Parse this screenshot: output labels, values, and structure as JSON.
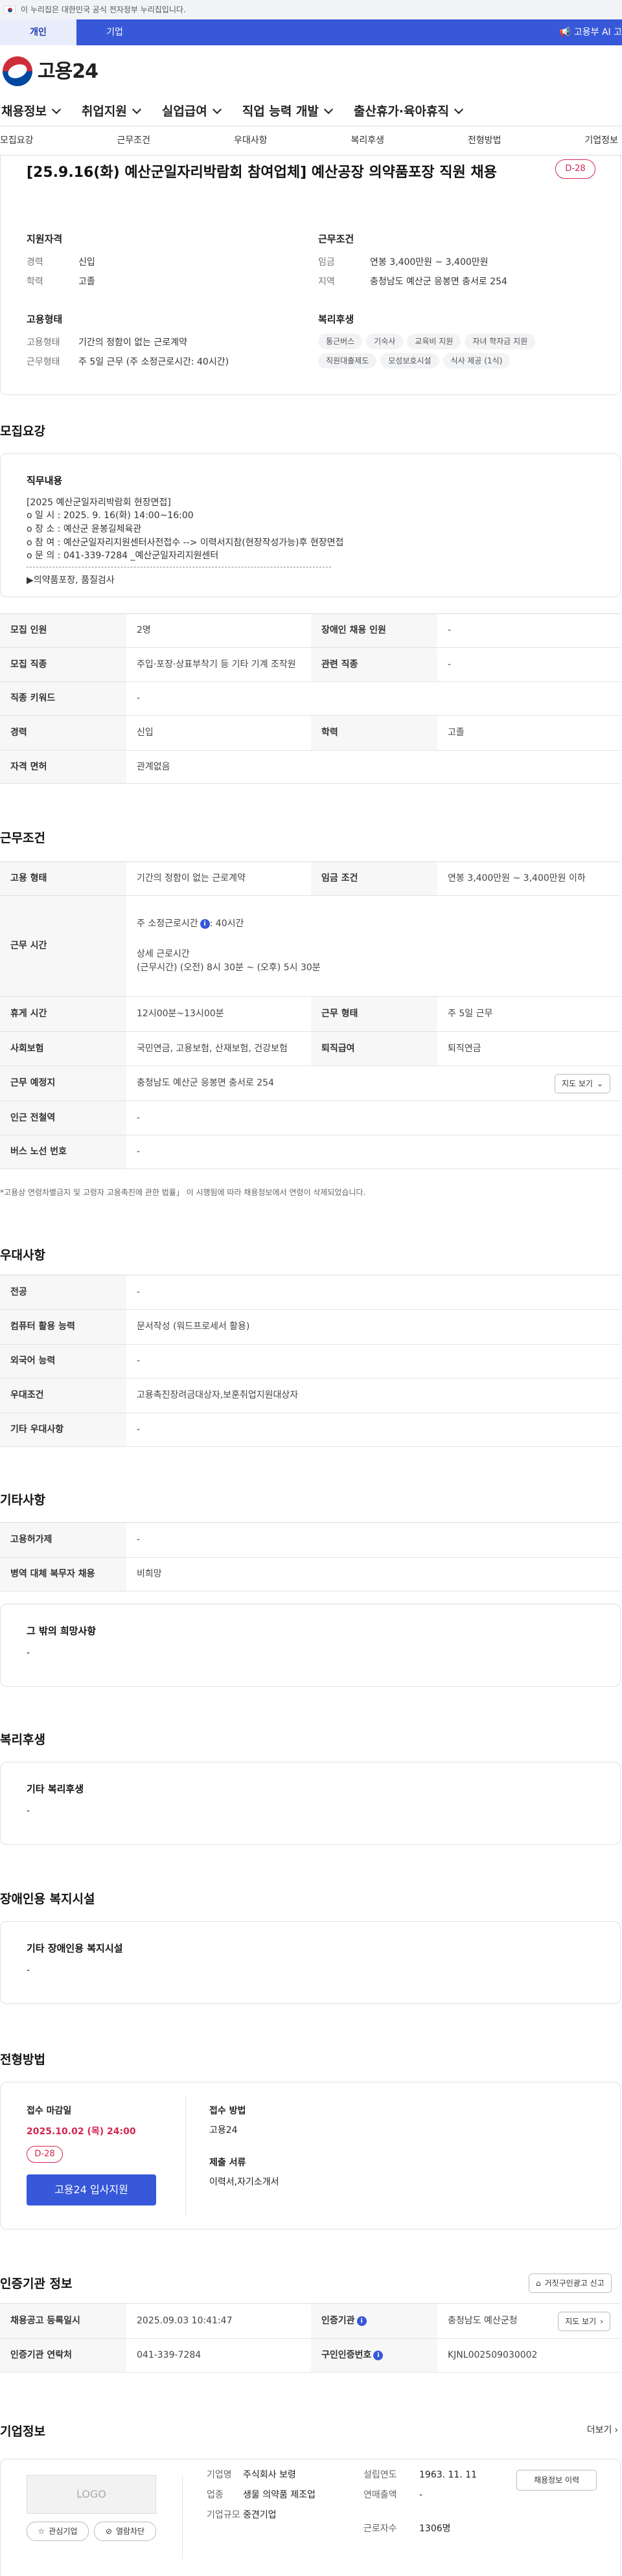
{
  "gov_banner": {
    "text": "이 누리집은 대한민국 공식 전자정부 누리집입니다."
  },
  "user_tabs": {
    "personal": "개인",
    "company": "기업",
    "ai": "고용부 AI 고"
  },
  "logo": {
    "text": "고용24"
  },
  "gnb": [
    "채용정보",
    "취업지원",
    "실업급여",
    "직업 능력 개발",
    "출산휴가·육아휴직"
  ],
  "anchor_nav": [
    "모집요강",
    "근무조건",
    "우대사항",
    "복리후생",
    "전형방법",
    "기업정보"
  ],
  "summary": {
    "title": "[25.9.16(화) 예산군일자리박람회 참여업체] 예산공장 의약품포장 직원 채용",
    "dday": "D-28",
    "qualification": {
      "heading": "지원자격",
      "rows": [
        {
          "k": "경력",
          "v": "신입"
        },
        {
          "k": "학력",
          "v": "고졸"
        }
      ]
    },
    "employment": {
      "heading": "고용형태",
      "rows": [
        {
          "k": "고용형태",
          "v": "기간의 정함이 없는 근로계약"
        },
        {
          "k": "근무형태",
          "v": "주 5일 근무 (주 소정근로시간: 40시간)"
        }
      ]
    },
    "conditions": {
      "heading": "근무조건",
      "rows": [
        {
          "k": "임금",
          "v": "연봉 3,400만원 ~ 3,400만원"
        },
        {
          "k": "지역",
          "v": "충청남도 예산군 응봉면 충서로 254"
        }
      ]
    },
    "welfare": {
      "heading": "복리후생",
      "tags": [
        "통근버스",
        "기숙사",
        "교육비 지원",
        "자녀 학자금 지원",
        "직원대출제도",
        "모성보호시설",
        "식사 제공 (1식)"
      ]
    }
  },
  "recruit": {
    "heading": "모집요강",
    "content_label": "직무내용",
    "content_lines": [
      "[2025 예산군일자리박람회 현장면접]",
      "o 일 시 : 2025. 9. 16(화) 14:00~16:00",
      "o 장 소 : 예산군 윤봉길체육관",
      "o 참 여 : 예산군일자리지원센터사전접수 --> 이력서지참(현장작성가능)후 현장면접",
      "o 문 의 : 041-339-7284 _예산군일자리지원센터"
    ],
    "content_footer": "▶의약품포장, 품질검사",
    "table": [
      {
        "k": "모집 인원",
        "v": "2명",
        "k2": "장애인 채용 인원",
        "v2": "-"
      },
      {
        "k": "모집 직종",
        "v": "주입·포장·상표부착기 등 기타 기계 조작원",
        "k2": "관련 직종",
        "v2": "-"
      },
      {
        "k": "직종 키워드",
        "v": "-"
      },
      {
        "k": "경력",
        "v": "신입",
        "k2": "학력",
        "v2": "고졸"
      },
      {
        "k": "자격 면허",
        "v": "관계없음"
      }
    ]
  },
  "work": {
    "heading": "근무조건",
    "employment_type": {
      "k": "고용 형태",
      "v": "기간의 정함이 없는 근로계약",
      "k2": "임금 조건",
      "v2": "연봉 3,400만원 ~ 3,400만원 이하"
    },
    "work_time": {
      "k": "근무 시간",
      "line1": "주 소정근로시간",
      "line1b": ": 40시간",
      "line2": "상세 근로시간",
      "line3": "(근무시간) (오전) 8시 30분 ~ (오후) 5시 30분"
    },
    "rest": {
      "k": "휴게 시간",
      "v": "12시00분~13시00분",
      "k2": "근무 형태",
      "v2": "주 5일 근무"
    },
    "insurance": {
      "k": "사회보험",
      "v": "국민연금, 고용보험, 산재보험, 건강보험",
      "k2": "퇴직급여",
      "v2": "퇴직연금"
    },
    "location": {
      "k": "근무 예정지",
      "v": "충청남도 예산군 응봉면 충서로 254",
      "button": "지도 보기"
    },
    "station": {
      "k": "인근 전철역",
      "v": "-"
    },
    "bus": {
      "k": "버스 노선 번호",
      "v": "-"
    },
    "note": "*고용상 연령차별금지 및 고령자 고용촉진에 관한 법률」 이 시행됨에 따라 채용정보에서 연령이 삭제되었습니다."
  },
  "preference": {
    "heading": "우대사항",
    "rows": [
      {
        "k": "전공",
        "v": "-"
      },
      {
        "k": "컴퓨터 활용 능력",
        "v": "문서작성 (워드프로세서 활용)"
      },
      {
        "k": "외국어 능력",
        "v": "-"
      },
      {
        "k": "우대조건",
        "v": "고용촉진장려금대상자,보훈취업지원대상자"
      },
      {
        "k": "기타 우대사항",
        "v": "-"
      }
    ]
  },
  "etc": {
    "heading": "기타사항",
    "rows": [
      {
        "k": "고용허가제",
        "v": "-"
      },
      {
        "k": "병역 대체 복무자 채용",
        "v": "비희망"
      }
    ],
    "other_title": "그 밖의 희망사항",
    "other_value": "-"
  },
  "welfare_section": {
    "heading": "복리후생",
    "label": "기타 복리후생",
    "value": "-"
  },
  "disability": {
    "heading": "장애인용 복지시설",
    "label": "기타 장애인용 복지시설",
    "value": "-"
  },
  "selection": {
    "heading": "전형방법",
    "deadline_label": "접수 마감일",
    "deadline": "2025.10.02 (목) 24:00",
    "dday": "D-28",
    "apply_button": "고용24 입사지원",
    "method_label": "접수 방법",
    "method": "고용24",
    "docs_label": "제출 서류",
    "docs": "이력서,자기소개서"
  },
  "cert": {
    "heading": "인증기관 정보",
    "report_button": "거짓구인광고 신고",
    "rows": [
      {
        "k": "채용공고 등록일시",
        "v": "2025.09.03 10:41:47",
        "k2": "인증기관",
        "v2": "충청남도 예산군청",
        "button": "지도 보기"
      },
      {
        "k": "인증기관 연락처",
        "v": "041-339-7284",
        "k2": "구인인증번호",
        "v2": "KJNL002509030002"
      }
    ]
  },
  "company": {
    "heading": "기업정보",
    "more": "더보기",
    "logo": "LOGO",
    "fav_button": "관심기업",
    "block_button": "열람차단",
    "fields": [
      {
        "k": "기업명",
        "v": "주식회사 보령"
      },
      {
        "k": "업종",
        "v": "생물 의약품 제조업"
      },
      {
        "k": "기업규모",
        "v": "중견기업"
      }
    ],
    "fields2": [
      {
        "k": "설립연도",
        "v": "1963. 11. 11"
      },
      {
        "k": "연매출액",
        "v": "-"
      },
      {
        "k": "근로자수",
        "v": "1306명"
      }
    ],
    "history_button": "채용정보 이력"
  }
}
